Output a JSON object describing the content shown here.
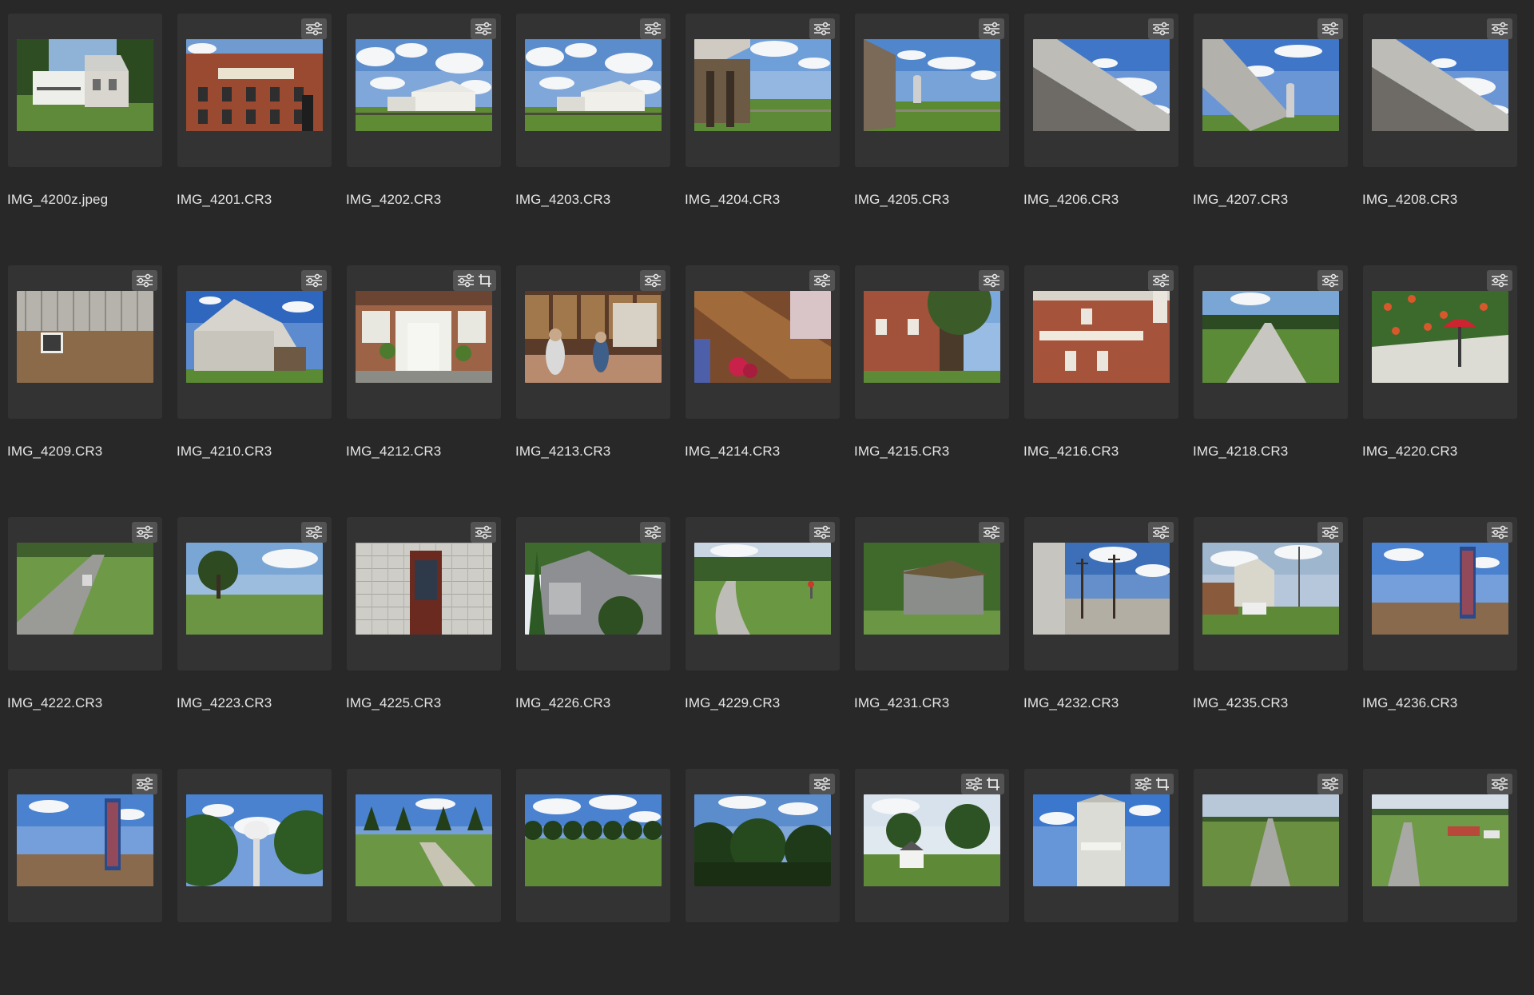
{
  "window": {
    "title": "",
    "background": "#282828"
  },
  "icons": {
    "adjust": "sliders-icon",
    "crop": "crop-icon"
  },
  "photos": [
    {
      "name": "IMG_4200z.jpeg",
      "badges": [],
      "scene": "house"
    },
    {
      "name": "IMG_4201.CR3",
      "badges": [
        "adjust"
      ],
      "scene": "brick-shop"
    },
    {
      "name": "IMG_4202.CR3",
      "badges": [
        "adjust"
      ],
      "scene": "barn-field"
    },
    {
      "name": "IMG_4203.CR3",
      "badges": [
        "adjust"
      ],
      "scene": "barn-field"
    },
    {
      "name": "IMG_4204.CR3",
      "badges": [
        "adjust"
      ],
      "scene": "barn-shed"
    },
    {
      "name": "IMG_4205.CR3",
      "badges": [
        "adjust"
      ],
      "scene": "barn-silo"
    },
    {
      "name": "IMG_4206.CR3",
      "badges": [
        "adjust"
      ],
      "scene": "roof-sky"
    },
    {
      "name": "IMG_4207.CR3",
      "badges": [
        "adjust"
      ],
      "scene": "roof-silo"
    },
    {
      "name": "IMG_4208.CR3",
      "badges": [
        "adjust"
      ],
      "scene": "roof-sky"
    },
    {
      "name": "IMG_4209.CR3",
      "badges": [
        "adjust"
      ],
      "scene": "stone-wall"
    },
    {
      "name": "IMG_4210.CR3",
      "badges": [
        "adjust"
      ],
      "scene": "barn-blue"
    },
    {
      "name": "IMG_4212.CR3",
      "badges": [
        "adjust",
        "crop"
      ],
      "scene": "porch"
    },
    {
      "name": "IMG_4213.CR3",
      "badges": [
        "adjust"
      ],
      "scene": "shop-interior"
    },
    {
      "name": "IMG_4214.CR3",
      "badges": [
        "adjust"
      ],
      "scene": "quilt-stairs"
    },
    {
      "name": "IMG_4215.CR3",
      "badges": [
        "adjust"
      ],
      "scene": "brick-tree"
    },
    {
      "name": "IMG_4216.CR3",
      "badges": [
        "adjust"
      ],
      "scene": "brick-gifts"
    },
    {
      "name": "IMG_4218.CR3",
      "badges": [
        "adjust"
      ],
      "scene": "country-road"
    },
    {
      "name": "IMG_4220.CR3",
      "badges": [
        "adjust"
      ],
      "scene": "lamp-flowers"
    },
    {
      "name": "IMG_4222.CR3",
      "badges": [
        "adjust"
      ],
      "scene": "highway"
    },
    {
      "name": "IMG_4223.CR3",
      "badges": [
        "adjust"
      ],
      "scene": "tree-hill"
    },
    {
      "name": "IMG_4225.CR3",
      "badges": [
        "adjust"
      ],
      "scene": "block-door"
    },
    {
      "name": "IMG_4226.CR3",
      "badges": [
        "adjust"
      ],
      "scene": "gray-house"
    },
    {
      "name": "IMG_4229.CR3",
      "badges": [
        "adjust"
      ],
      "scene": "curve-road"
    },
    {
      "name": "IMG_4231.CR3",
      "badges": [
        "adjust"
      ],
      "scene": "shed-trees"
    },
    {
      "name": "IMG_4232.CR3",
      "badges": [
        "adjust"
      ],
      "scene": "poles-lot"
    },
    {
      "name": "IMG_4235.CR3",
      "badges": [
        "adjust"
      ],
      "scene": "farmhouse-truck"
    },
    {
      "name": "IMG_4236.CR3",
      "badges": [
        "adjust"
      ],
      "scene": "motel-sign"
    },
    {
      "name": "",
      "badges": [
        "adjust"
      ],
      "scene": "motel-sign"
    },
    {
      "name": "",
      "badges": [],
      "scene": "water-tower"
    },
    {
      "name": "",
      "badges": [],
      "scene": "pine-path"
    },
    {
      "name": "",
      "badges": [],
      "scene": "tree-row"
    },
    {
      "name": "",
      "badges": [
        "adjust"
      ],
      "scene": "trees-sky"
    },
    {
      "name": "",
      "badges": [
        "adjust",
        "crop"
      ],
      "scene": "white-house"
    },
    {
      "name": "",
      "badges": [
        "adjust",
        "crop"
      ],
      "scene": "elevator"
    },
    {
      "name": "",
      "badges": [
        "adjust"
      ],
      "scene": "straight-road"
    },
    {
      "name": "",
      "badges": [
        "adjust"
      ],
      "scene": "valley-road"
    }
  ]
}
